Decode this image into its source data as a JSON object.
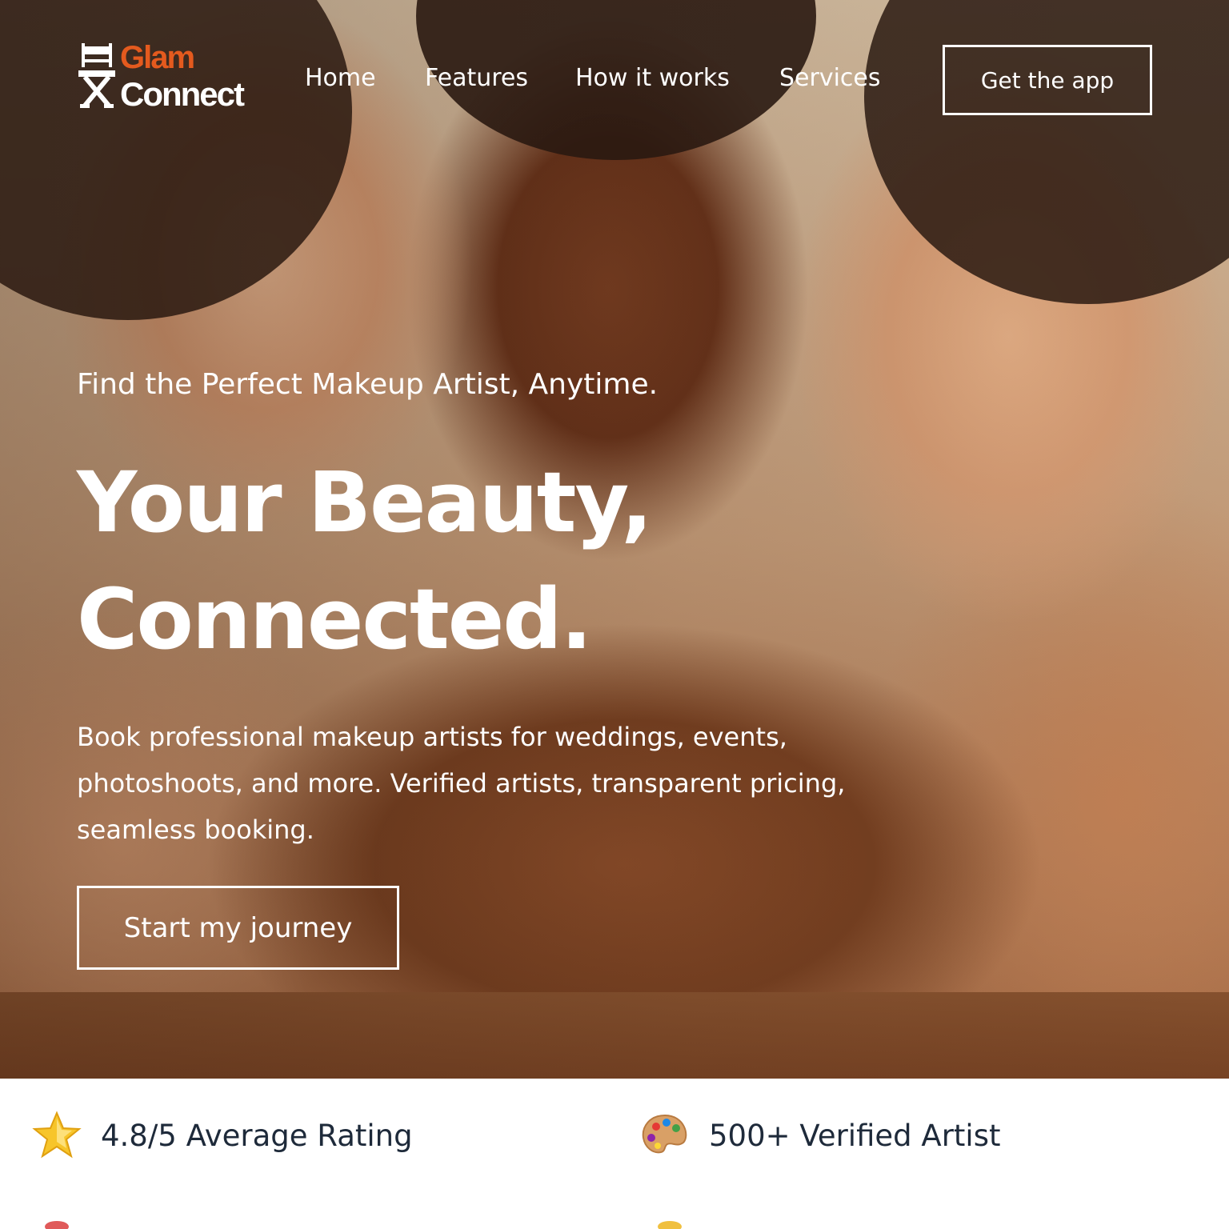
{
  "brand": {
    "line1": "Glam",
    "line2": "Connect",
    "accent": "#e45a1e"
  },
  "nav": {
    "items": [
      "Home",
      "Features",
      "How it works",
      "Services"
    ],
    "cta_label": "Get the app"
  },
  "hero": {
    "tagline": "Find the Perfect Makeup Artist, Anytime.",
    "headline_line1": "Your Beauty,",
    "headline_line2": "Connected.",
    "description": "Book professional makeup artists for weddings, events, photoshoots, and more. Verified artists, transparent pricing, seamless booking.",
    "cta_label": "Start my journey"
  },
  "stats": [
    {
      "icon": "star-icon",
      "label": "4.8/5 Average Rating"
    },
    {
      "icon": "artist-palette-icon",
      "label": "500+ Verified Artist"
    }
  ],
  "colors": {
    "text_dark": "#1e2a3a",
    "white": "#ffffff"
  }
}
